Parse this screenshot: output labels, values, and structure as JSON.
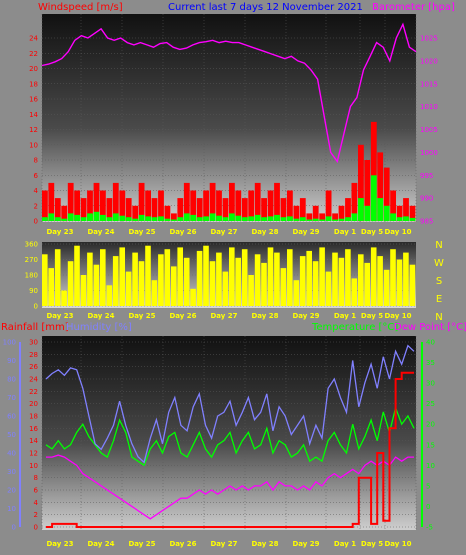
{
  "title": "Current last 7 days 12 November 2021",
  "colors": {
    "wind": "#ff0000",
    "gust_fill": "#ff0000",
    "wind_avg": "#00ff00",
    "pressure": "#ff00ff",
    "direction": "#ffff00",
    "rainfall": "#ff0000",
    "humidity": "#8080ff",
    "temperature": "#00ff00",
    "dewpoint": "#ff00ff",
    "title": "#0000ff"
  },
  "chart_data": [
    {
      "type": "line",
      "panel": "wind-pressure",
      "title": "Current last 7 days 12 November 2021",
      "ylabel_left": "Windspeed [m/s]",
      "ylabel_right": "Barometer [hpa]",
      "ylim_left": [
        0,
        24
      ],
      "ylim_right": [
        985,
        1025
      ],
      "yticks_left": [
        0,
        2,
        4,
        6,
        8,
        10,
        12,
        14,
        16,
        18,
        20,
        22,
        24
      ],
      "yticks_right": [
        985,
        990,
        995,
        1000,
        1005,
        1010,
        1015,
        1020,
        1025
      ],
      "x_labels": [
        "Day 23",
        "Day 24",
        "Day 25",
        "Day 26",
        "Day 27",
        "Day 28",
        "Day 29",
        "Day 1",
        "Day 5",
        "Day 10"
      ],
      "series": [
        {
          "name": "Barometer",
          "axis": "right",
          "values": [
            1019,
            1019.3,
            1019.8,
            1020.5,
            1022,
            1024.5,
            1025.5,
            1025,
            1026,
            1027,
            1025,
            1024.5,
            1025,
            1024,
            1023.5,
            1024,
            1023.5,
            1023,
            1023.8,
            1024,
            1023,
            1022.5,
            1022.8,
            1023.5,
            1024,
            1024.2,
            1024.5,
            1024,
            1024.3,
            1024,
            1024,
            1023.5,
            1023,
            1022.5,
            1022,
            1021.5,
            1021,
            1020.5,
            1021,
            1020,
            1019.5,
            1018,
            1016,
            1008,
            1000,
            998,
            1004,
            1010,
            1012,
            1018,
            1021,
            1024,
            1023,
            1020,
            1025,
            1028,
            1023,
            1022
          ]
        },
        {
          "name": "Gust",
          "axis": "left",
          "values": [
            4,
            5,
            3,
            2,
            5,
            4,
            3,
            4,
            5,
            4,
            3,
            5,
            4,
            3,
            2,
            5,
            4,
            3,
            4,
            2,
            1,
            3,
            5,
            4,
            3,
            4,
            5,
            4,
            3,
            5,
            4,
            3,
            4,
            5,
            3,
            4,
            5,
            3,
            4,
            2,
            3,
            1,
            2,
            1,
            4,
            1,
            2,
            3,
            5,
            10,
            8,
            13,
            9,
            7,
            4,
            2,
            3,
            2
          ]
        },
        {
          "name": "Average",
          "axis": "left",
          "values": [
            0.5,
            1,
            0.5,
            0.3,
            1,
            0.8,
            0.5,
            1,
            1.2,
            0.8,
            0.5,
            1,
            0.7,
            0.5,
            0.3,
            0.8,
            0.6,
            0.5,
            0.6,
            0.3,
            0.2,
            0.5,
            1,
            0.8,
            0.5,
            0.6,
            1,
            0.7,
            0.5,
            1,
            0.7,
            0.5,
            0.6,
            0.8,
            0.5,
            0.6,
            0.8,
            0.5,
            0.6,
            0.3,
            0.5,
            0.2,
            0.3,
            0.2,
            0.6,
            0.2,
            0.3,
            0.5,
            1,
            3,
            2,
            6,
            3,
            2,
            1,
            0.5,
            0.6,
            0.4
          ]
        }
      ]
    },
    {
      "type": "bar",
      "panel": "direction",
      "ylim": [
        0,
        360
      ],
      "yticks": [
        0,
        90,
        180,
        270,
        360
      ],
      "compass_labels": [
        "N",
        "W",
        "S",
        "E",
        "N"
      ],
      "x_labels": [
        "Day 23",
        "Day 24",
        "Day 25",
        "Day 26",
        "Day 27",
        "Day 28",
        "Day 29",
        "Day 1",
        "Day 5",
        "Day 10"
      ],
      "values": [
        300,
        220,
        330,
        90,
        260,
        350,
        180,
        310,
        240,
        330,
        120,
        290,
        340,
        200,
        310,
        260,
        350,
        150,
        300,
        330,
        230,
        340,
        280,
        100,
        320,
        350,
        260,
        310,
        200,
        340,
        280,
        330,
        180,
        300,
        250,
        340,
        310,
        220,
        330,
        150,
        290,
        320,
        260,
        340,
        200,
        310,
        280,
        330,
        160,
        300,
        250,
        340,
        290,
        210,
        330,
        270,
        310,
        240
      ]
    },
    {
      "type": "line",
      "panel": "rain-humidity-temperature",
      "ylabel_left_outer": "Rainfall [mm]",
      "ylabel_left_inner": "Humidity [%]",
      "ylabel_right_a": "Temperature [°C]",
      "ylabel_right_b": "Dew Point [°C]",
      "ylim_rain": [
        0,
        30
      ],
      "ylim_humidity": [
        0,
        100
      ],
      "ylim_temperature": [
        -5,
        40
      ],
      "yticks_rain": [
        0,
        2,
        4,
        6,
        8,
        10,
        12,
        14,
        16,
        18,
        20,
        22,
        24,
        26,
        28,
        30
      ],
      "yticks_humidity": [
        0,
        10,
        20,
        30,
        40,
        50,
        60,
        70,
        80,
        90,
        100
      ],
      "yticks_temperature": [
        -5,
        0,
        5,
        10,
        15,
        20,
        25,
        30,
        35,
        40
      ],
      "x_labels": [
        "Day 23",
        "Day 24",
        "Day 25",
        "Day 26",
        "Day 27",
        "Day 28",
        "Day 29",
        "Day 1",
        "Day 5",
        "Day 10"
      ],
      "series": [
        {
          "name": "Rainfall",
          "axis": "rain",
          "values": [
            0,
            0.5,
            0.5,
            0.5,
            0.5,
            0,
            0,
            0,
            0,
            0,
            0,
            0,
            0,
            0,
            0,
            0,
            0,
            0,
            0,
            0,
            0,
            0,
            0,
            0,
            0,
            0,
            0,
            0,
            0,
            0,
            0,
            0,
            0,
            0,
            0,
            0,
            0,
            0,
            0,
            0,
            0,
            0,
            0,
            0,
            0,
            0,
            0,
            0,
            0,
            0,
            0.5,
            8,
            8,
            0.5,
            12,
            1,
            16,
            24,
            25,
            25,
            25
          ]
        },
        {
          "name": "Humidity",
          "axis": "humidity",
          "values": [
            80,
            83,
            85,
            82,
            86,
            85,
            75,
            60,
            45,
            42,
            48,
            55,
            68,
            55,
            45,
            38,
            35,
            48,
            58,
            45,
            62,
            70,
            55,
            52,
            65,
            72,
            55,
            48,
            60,
            62,
            68,
            55,
            62,
            70,
            58,
            62,
            72,
            52,
            65,
            60,
            50,
            55,
            60,
            45,
            55,
            48,
            75,
            80,
            70,
            62,
            90,
            65,
            78,
            88,
            75,
            92,
            80,
            95,
            88,
            98,
            95
          ]
        },
        {
          "name": "Temperature",
          "axis": "temperature",
          "values": [
            15,
            14,
            16,
            14,
            15,
            18,
            20,
            17,
            15,
            13,
            12,
            16,
            21,
            18,
            12,
            11,
            10,
            14,
            16,
            13,
            17,
            18,
            13,
            12,
            15,
            18,
            14,
            12,
            15,
            16,
            18,
            13,
            16,
            18,
            14,
            15,
            19,
            13,
            16,
            15,
            12,
            13,
            15,
            11,
            12,
            11,
            16,
            18,
            15,
            13,
            20,
            14,
            17,
            21,
            16,
            23,
            18,
            24,
            20,
            22,
            19
          ]
        },
        {
          "name": "Dew Point",
          "axis": "temperature",
          "values": [
            12,
            12,
            12.5,
            12,
            11,
            10,
            8,
            7,
            6,
            5,
            4,
            3,
            2,
            1,
            0,
            -1,
            -2,
            -3,
            -2,
            -1,
            0,
            1,
            2,
            2,
            3,
            4,
            3,
            4,
            3,
            4,
            5,
            4,
            5,
            4,
            5,
            5,
            6,
            4,
            6,
            5,
            5,
            4,
            5,
            4,
            6,
            5,
            7,
            8,
            7,
            8,
            9,
            8,
            10,
            11,
            10,
            11,
            10,
            12,
            11,
            12,
            12
          ]
        }
      ]
    }
  ]
}
